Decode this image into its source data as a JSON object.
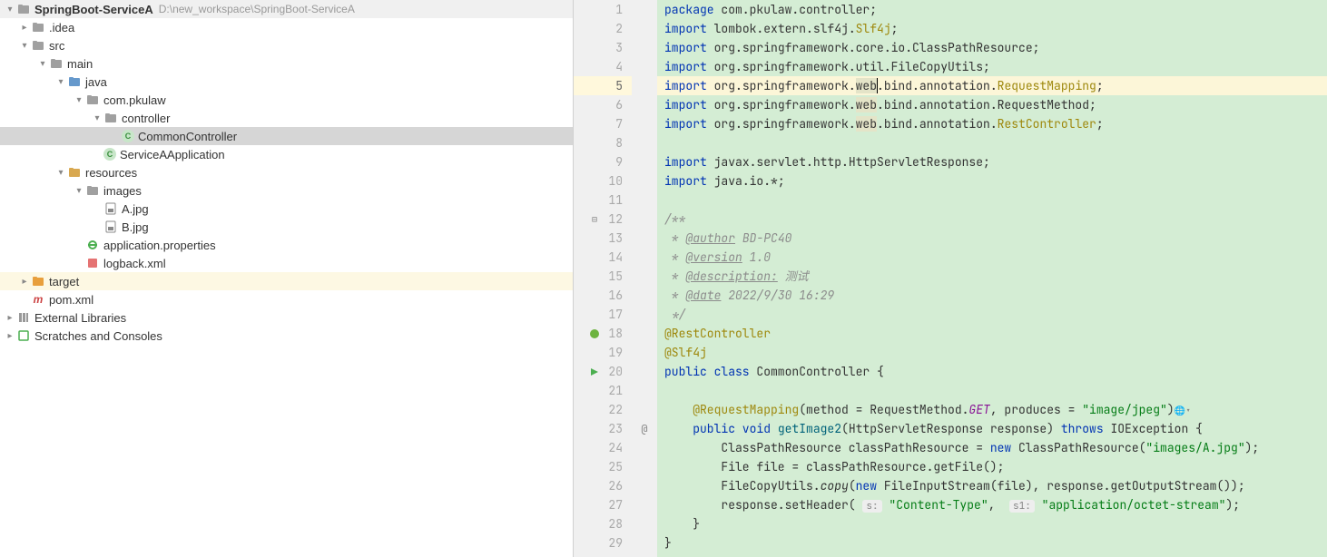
{
  "tree": {
    "root": {
      "name": "SpringBoot-ServiceA",
      "path": "D:\\new_workspace\\SpringBoot-ServiceA"
    },
    "idea": ".idea",
    "src": "src",
    "main": "main",
    "java": "java",
    "pkg": "com.pkulaw",
    "controller": "controller",
    "common_controller": "CommonController",
    "service_app": "ServiceAApplication",
    "resources": "resources",
    "images": "images",
    "a_jpg": "A.jpg",
    "b_jpg": "B.jpg",
    "app_props": "application.properties",
    "logback": "logback.xml",
    "target": "target",
    "pom": "pom.xml",
    "ext_lib": "External Libraries",
    "scratches": "Scratches and Consoles"
  },
  "editor": {
    "lines": {
      "l1_kw": "package",
      "l1_rest": " com.pkulaw.controller;",
      "l2_kw": "import",
      "l2_rest": " lombok.extern.slf4j.",
      "l2_cls": "Slf4j",
      "l2_end": ";",
      "l3_kw": "import",
      "l3_rest": " org.springframework.core.io.ClassPathResource;",
      "l4_kw": "import",
      "l4_rest": " org.springframework.util.FileCopyUtils;",
      "l5_kw": "import",
      "l5_a": " org.springframework.",
      "l5_web": "web",
      "l5_b": ".bind.annotation.",
      "l5_cls": "RequestMapping",
      "l5_end": ";",
      "l6_kw": "import",
      "l6_a": " org.springframework.",
      "l6_web": "web",
      "l6_b": ".bind.annotation.RequestMethod;",
      "l7_kw": "import",
      "l7_a": " org.springframework.",
      "l7_web": "web",
      "l7_b": ".bind.annotation.",
      "l7_cls": "RestController",
      "l7_end": ";",
      "l9_kw": "import",
      "l9_rest": " javax.servlet.http.HttpServletResponse;",
      "l10_kw": "import",
      "l10_rest": " java.io.*;",
      "l12": "/**",
      "l13_a": " * ",
      "l13_tag": "@author",
      "l13_b": " BD-PC40",
      "l14_a": " * ",
      "l14_tag": "@version",
      "l14_b": " 1.0",
      "l15_a": " * ",
      "l15_tag": "@description:",
      "l15_b": " 测试",
      "l16_a": " * ",
      "l16_tag": "@date",
      "l16_b": " 2022/9/30 16:29",
      "l17": " */",
      "l18": "@RestController",
      "l19": "@Slf4j",
      "l20_a": "public class ",
      "l20_b": "CommonController {",
      "l22_ann": "@RequestMapping",
      "l22_a": "(method = RequestMethod.",
      "l22_get": "GET",
      "l22_b": ", produces = ",
      "l22_str": "\"image/jpeg\"",
      "l22_c": ")",
      "l23_a": "public void ",
      "l23_m": "getImage2",
      "l23_b": "(HttpServletResponse response) ",
      "l23_throws": "throws",
      "l23_c": " IOException {",
      "l24_a": "ClassPathResource classPathResource = ",
      "l24_new": "new",
      "l24_b": " ClassPathResource(",
      "l24_str": "\"images/A.jpg\"",
      "l24_c": ");",
      "l25": "File file = classPathResource.getFile();",
      "l26_a": "FileCopyUtils.",
      "l26_copy": "copy",
      "l26_b": "(",
      "l26_new": "new",
      "l26_c": " FileInputStream(file), response.getOutputStream());",
      "l27_a": "response.setHeader( ",
      "l27_h1": "s:",
      "l27_s1": "\"Content-Type\"",
      "l27_b": ",  ",
      "l27_h2": "s1:",
      "l27_s2": "\"application/octet-stream\"",
      "l27_c": ");",
      "l28": "}",
      "l29": "}"
    },
    "line_count": 29,
    "current_line": 5,
    "marker_23": "@"
  }
}
